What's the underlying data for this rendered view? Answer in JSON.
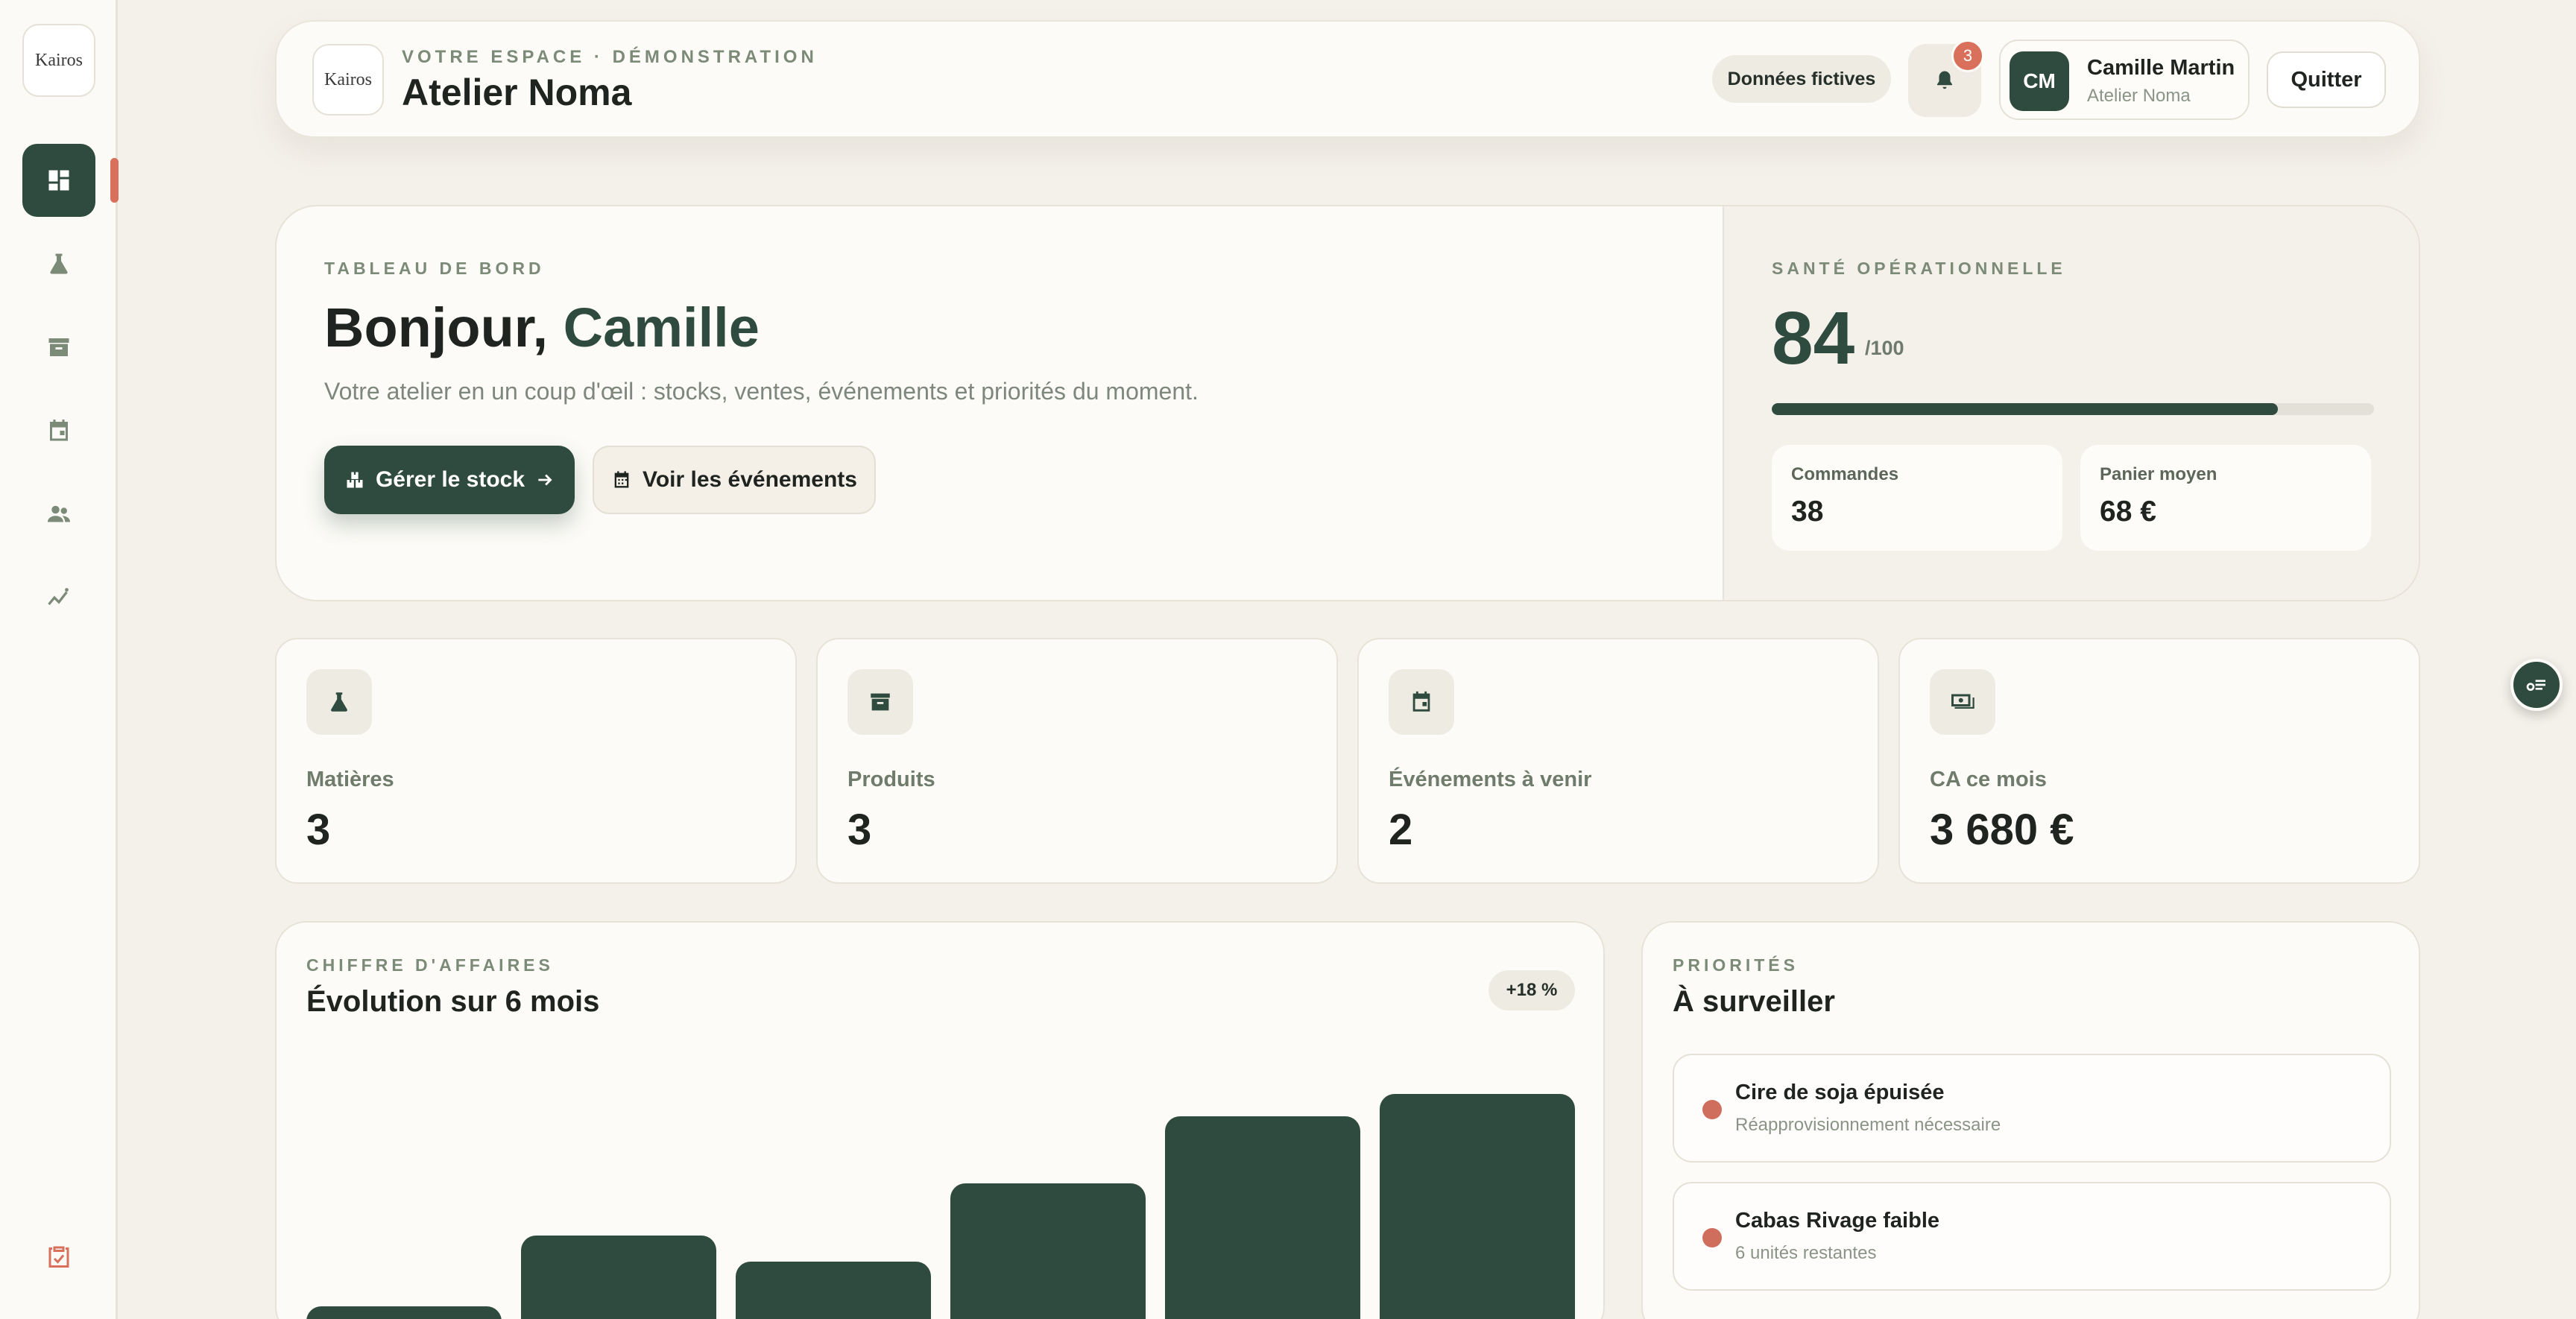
{
  "sidebar": {
    "logo": "Kairos",
    "items": [
      {
        "icon": "dashboard-icon",
        "active": true
      },
      {
        "icon": "flask-icon",
        "active": false
      },
      {
        "icon": "archive-box-icon",
        "active": false
      },
      {
        "icon": "calendar-icon",
        "active": false
      },
      {
        "icon": "people-icon",
        "active": false
      },
      {
        "icon": "analytics-icon",
        "active": false
      }
    ],
    "bottom_icon": "clipboard-check-icon",
    "accent": "#d9705c"
  },
  "header": {
    "logo": "Kairos",
    "eyebrow": "VOTRE ESPACE · DÉMONSTRATION",
    "title": "Atelier Noma",
    "chip": "Données fictives",
    "notifications": "3",
    "user": {
      "initials": "CM",
      "name": "Camille Martin",
      "org": "Atelier Noma"
    },
    "quit": "Quitter"
  },
  "hero": {
    "eyebrow": "TABLEAU DE BORD",
    "greeting": "Bonjour,",
    "name": "Camille",
    "subtitle": "Votre atelier en un coup d'œil : stocks, ventes, événements et priorités du moment.",
    "primary_btn": "Gérer le stock",
    "secondary_btn": "Voir les événements",
    "health": {
      "eyebrow": "SANTÉ OPÉRATIONNELLE",
      "score": "84",
      "max": "/100",
      "progress": 0.84,
      "orders_label": "Commandes",
      "orders_value": "38",
      "basket_label": "Panier moyen",
      "basket_value": "68 €"
    }
  },
  "kpis": [
    {
      "icon": "flask-icon",
      "label": "Matières",
      "value": "3"
    },
    {
      "icon": "archive-box-icon",
      "label": "Produits",
      "value": "3"
    },
    {
      "icon": "calendar-icon",
      "label": "Événements à venir",
      "value": "2"
    },
    {
      "icon": "cash-icon",
      "label": "CA ce mois",
      "value": "3 680 €"
    }
  ],
  "chart_card": {
    "eyebrow": "CHIFFRE D'AFFAIRES",
    "title": "Évolution sur 6 mois",
    "trend": "+18 %"
  },
  "chart_data": {
    "type": "bar",
    "title": "Évolution sur 6 mois",
    "values": [
      45,
      140,
      105,
      210,
      300,
      330
    ],
    "ylim": [
      0,
      390
    ],
    "grid": false
  },
  "priorities": {
    "eyebrow": "PRIORITÉS",
    "title": "À surveiller",
    "items": [
      {
        "title": "Cire de soja épuisée",
        "sub": "Réapprovisionnement nécessaire"
      },
      {
        "title": "Cabas Rivage faible",
        "sub": "6 unités restantes"
      }
    ]
  },
  "colors": {
    "primary": "#2f4a3e",
    "accent": "#d9705c",
    "background": "#f4f1ea",
    "card": "#fcfbf7"
  }
}
